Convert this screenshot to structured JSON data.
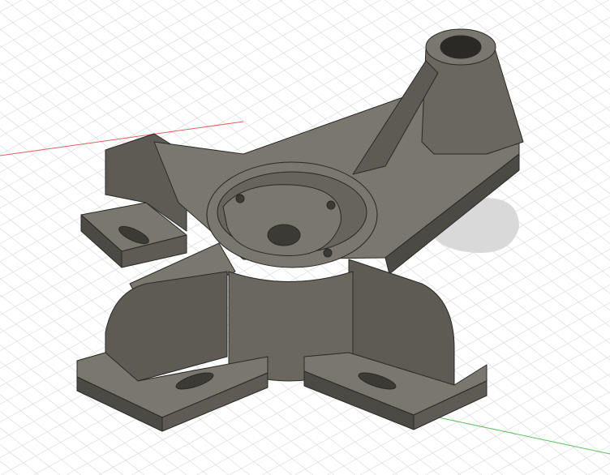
{
  "viewport": {
    "background": "#ffffff",
    "grid_color": "#dcdcdc",
    "x_axis_color": "#e06060",
    "y_axis_color": "#60c060",
    "model_colors": {
      "top": "#7a776e",
      "side_light": "#6a675f",
      "side_dark": "#4c4a44",
      "edge": "#2a2926",
      "shadow": "#d9d9d9"
    }
  }
}
